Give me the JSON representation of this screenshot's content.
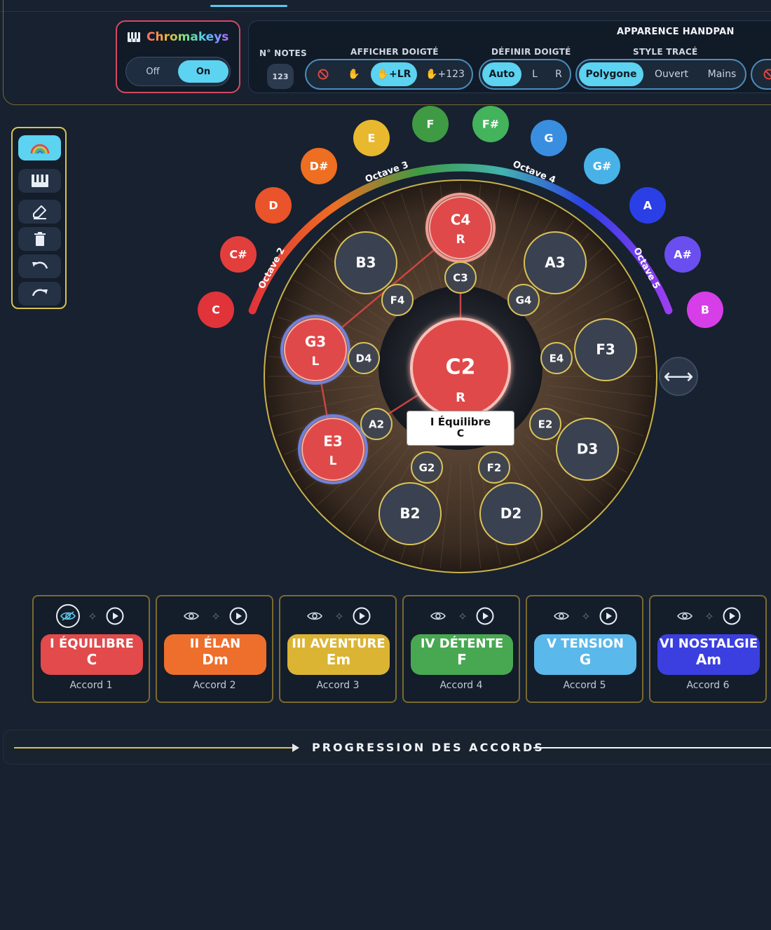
{
  "header": {
    "chromakeys": {
      "title": "Chromakeys",
      "off_label": "Off",
      "on_label": "On",
      "selected": "On"
    },
    "panel_title": "APPARENCE HANDPAN",
    "num_notes": {
      "label": "N° NOTES",
      "button": "123"
    },
    "afficher_doigte": {
      "label": "AFFICHER DOIGTÉ",
      "options": [
        "no-icon",
        "hand-icon",
        "+LR",
        "+123"
      ],
      "selected": "+LR"
    },
    "definir_doigte": {
      "label": "DÉFINIR DOIGTÉ",
      "options": [
        "Auto",
        "L",
        "R"
      ],
      "selected": "Auto"
    },
    "style_trace": {
      "label": "STYLE TRACÉ",
      "options": [
        "Polygone",
        "Ouvert",
        "Mains"
      ],
      "selected": "Polygone"
    }
  },
  "toolbar": {
    "tools": [
      "rainbow-icon",
      "piano-icon",
      "eraser-icon",
      "trash-icon",
      "undo-icon",
      "redo-icon"
    ],
    "selected": "rainbow-icon"
  },
  "chromatic_ring": {
    "notes": [
      "C",
      "C#",
      "D",
      "D#",
      "E",
      "F",
      "F#",
      "G",
      "G#",
      "A",
      "A#",
      "B"
    ],
    "colors": [
      "#e0343a",
      "#e23e3c",
      "#e9542a",
      "#ee6e22",
      "#e8b82f",
      "#3f9a44",
      "#43b35c",
      "#3a8ee0",
      "#48b2e8",
      "#2b3fe6",
      "#6a4ef0",
      "#d63ee8"
    ],
    "octave_labels": [
      "Octave 2",
      "Octave 3",
      "Octave 4",
      "Octave 5"
    ]
  },
  "handpan": {
    "center": {
      "name": "C2",
      "hand": "R",
      "active": true
    },
    "outer_notes": [
      {
        "name": "C4",
        "hand": "R",
        "active": true
      },
      {
        "name": "A3",
        "active": false
      },
      {
        "name": "F3",
        "active": false
      },
      {
        "name": "D3",
        "active": false
      },
      {
        "name": "D2",
        "active": false
      },
      {
        "name": "B2",
        "active": false
      },
      {
        "name": "E3",
        "hand": "L",
        "active": true
      },
      {
        "name": "G3",
        "hand": "L",
        "active": true
      },
      {
        "name": "B3",
        "active": false
      }
    ],
    "small_notes": [
      "C3",
      "G4",
      "E4",
      "E2",
      "F2",
      "G2",
      "A2",
      "D4",
      "F4"
    ],
    "tooltip": {
      "line1": "I Équilibre",
      "line2": "C"
    }
  },
  "chords": [
    {
      "numeral_name": "I ÉQUILIBRE",
      "chord": "C",
      "accord": "Accord 1",
      "color": "#e24a4c",
      "selected": true
    },
    {
      "numeral_name": "II ÉLAN",
      "chord": "Dm",
      "accord": "Accord 2",
      "color": "#ee6e2c",
      "selected": false
    },
    {
      "numeral_name": "III AVENTURE",
      "chord": "Em",
      "accord": "Accord 3",
      "color": "#dcb433",
      "selected": false
    },
    {
      "numeral_name": "IV DÉTENTE",
      "chord": "F",
      "accord": "Accord 4",
      "color": "#48a852",
      "selected": false
    },
    {
      "numeral_name": "V TENSION",
      "chord": "G",
      "accord": "Accord 5",
      "color": "#5ab8ea",
      "selected": false
    },
    {
      "numeral_name": "VI NOSTALGIE",
      "chord": "Am",
      "accord": "Accord 6",
      "color": "#3b3fe0",
      "selected": false
    }
  ],
  "progression": {
    "title": "PROGRESSION DES ACCORDS"
  }
}
